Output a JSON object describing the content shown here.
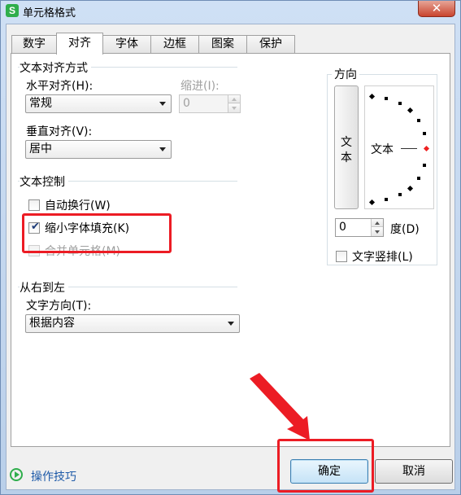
{
  "window": {
    "title": "单元格格式",
    "app_icon": "S",
    "close_label": "✕"
  },
  "tabs": [
    {
      "label": "数字"
    },
    {
      "label": "对齐",
      "active": true
    },
    {
      "label": "字体"
    },
    {
      "label": "边框"
    },
    {
      "label": "图案"
    },
    {
      "label": "保护"
    }
  ],
  "alignment": {
    "group_title": "文本对齐方式",
    "horizontal_label": "水平对齐(H):",
    "horizontal_value": "常规",
    "indent_label": "缩进(I):",
    "indent_value": "0",
    "vertical_label": "垂直对齐(V):",
    "vertical_value": "居中"
  },
  "text_control": {
    "group_title": "文本控制",
    "wrap_label": "自动换行(W)",
    "wrap_checked": false,
    "shrink_label": "缩小字体填充(K)",
    "shrink_checked": true,
    "merge_label": "合并单元格(M)",
    "merge_checked": false,
    "check_glyph": "✔"
  },
  "rtl": {
    "group_title": "从右到左",
    "direction_label": "文字方向(T):",
    "direction_value": "根据内容"
  },
  "orientation": {
    "group_title": "方向",
    "vertical_text_1": "文",
    "vertical_text_2": "本",
    "dial_text": "文本",
    "degree_value": "0",
    "degree_label": "度(D)",
    "vertical_stack_label": "文字竖排(L)",
    "vertical_stack_checked": false
  },
  "footer": {
    "tips_label": "操作技巧",
    "ok_label": "确定",
    "cancel_label": "取消"
  },
  "colors": {
    "annotation_red": "#ec1c24",
    "link_blue": "#1e5aa8",
    "brand_green": "#2fae4c"
  }
}
